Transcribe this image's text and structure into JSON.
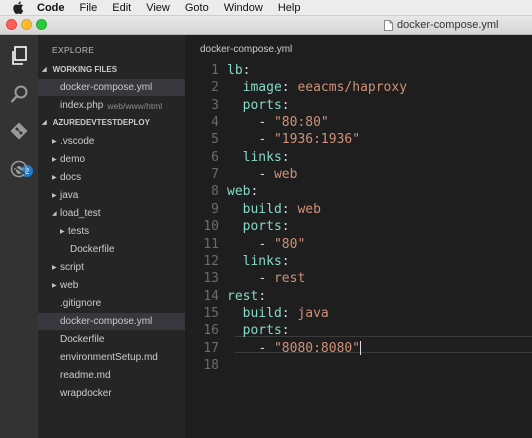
{
  "menubar": {
    "icon": "apple-icon",
    "items": [
      "Code",
      "File",
      "Edit",
      "View",
      "Goto",
      "Window",
      "Help"
    ]
  },
  "window": {
    "title": "docker-compose.yml",
    "traffic_colors": {
      "close": "#fc5f57",
      "minimize": "#fdbc2e",
      "maximize": "#29c940"
    }
  },
  "activity_bar": {
    "icons": [
      "explorer-icon",
      "search-icon",
      "git-icon",
      "debug-icon"
    ],
    "git_badge": "2"
  },
  "sidebar": {
    "title": "EXPLORE",
    "working_files_header": "WORKING FILES",
    "working_files": [
      {
        "name": "docker-compose.yml",
        "path": ""
      },
      {
        "name": "index.php",
        "path": "web/www/html"
      }
    ],
    "project_header": "AZUREDEVTESTDEPLOY",
    "tree": [
      {
        "label": ".vscode",
        "marker": "▶"
      },
      {
        "label": "demo",
        "marker": "▶"
      },
      {
        "label": "docs",
        "marker": "▶"
      },
      {
        "label": "java",
        "marker": "▶"
      },
      {
        "label": "load_test",
        "marker": "◢"
      },
      {
        "label": "tests",
        "marker": "▶"
      },
      {
        "label": "Dockerfile",
        "marker": ""
      },
      {
        "label": "script",
        "marker": "▶"
      },
      {
        "label": "web",
        "marker": "▶"
      },
      {
        "label": ".gitignore",
        "marker": ""
      },
      {
        "label": "docker-compose.yml",
        "marker": ""
      },
      {
        "label": "Dockerfile",
        "marker": ""
      },
      {
        "label": "environmentSetup.md",
        "marker": ""
      },
      {
        "label": "readme.md",
        "marker": ""
      },
      {
        "label": "wrapdocker",
        "marker": ""
      }
    ]
  },
  "editor": {
    "tab_title": "docker-compose.yml",
    "lines": [
      {
        "n": "1",
        "indent": "",
        "key": "lb",
        "punct": ":",
        "val": ""
      },
      {
        "n": "2",
        "indent": "  ",
        "key": "image",
        "punct": ": ",
        "val": "eeacms/haproxy"
      },
      {
        "n": "3",
        "indent": "  ",
        "key": "ports",
        "punct": ":",
        "val": ""
      },
      {
        "n": "4",
        "indent": "    ",
        "key": "",
        "punct": "- ",
        "val": "\"80:80\""
      },
      {
        "n": "5",
        "indent": "    ",
        "key": "",
        "punct": "- ",
        "val": "\"1936:1936\""
      },
      {
        "n": "6",
        "indent": "  ",
        "key": "links",
        "punct": ":",
        "val": ""
      },
      {
        "n": "7",
        "indent": "    ",
        "key": "",
        "punct": "- ",
        "val": "web"
      },
      {
        "n": "8",
        "indent": "",
        "key": "web",
        "punct": ":",
        "val": ""
      },
      {
        "n": "9",
        "indent": "  ",
        "key": "build",
        "punct": ": ",
        "val": "web"
      },
      {
        "n": "10",
        "indent": "  ",
        "key": "ports",
        "punct": ":",
        "val": ""
      },
      {
        "n": "11",
        "indent": "    ",
        "key": "",
        "punct": "- ",
        "val": "\"80\""
      },
      {
        "n": "12",
        "indent": "  ",
        "key": "links",
        "punct": ":",
        "val": ""
      },
      {
        "n": "13",
        "indent": "    ",
        "key": "",
        "punct": "- ",
        "val": "rest"
      },
      {
        "n": "14",
        "indent": "",
        "key": "rest",
        "punct": ":",
        "val": ""
      },
      {
        "n": "15",
        "indent": "  ",
        "key": "build",
        "punct": ": ",
        "val": "java"
      },
      {
        "n": "16",
        "indent": "  ",
        "key": "ports",
        "punct": ":",
        "val": ""
      },
      {
        "n": "17",
        "indent": "    ",
        "key": "",
        "punct": "- ",
        "val": "\"8080:8080\""
      },
      {
        "n": "18",
        "indent": "",
        "key": "",
        "punct": "",
        "val": ""
      }
    ]
  }
}
